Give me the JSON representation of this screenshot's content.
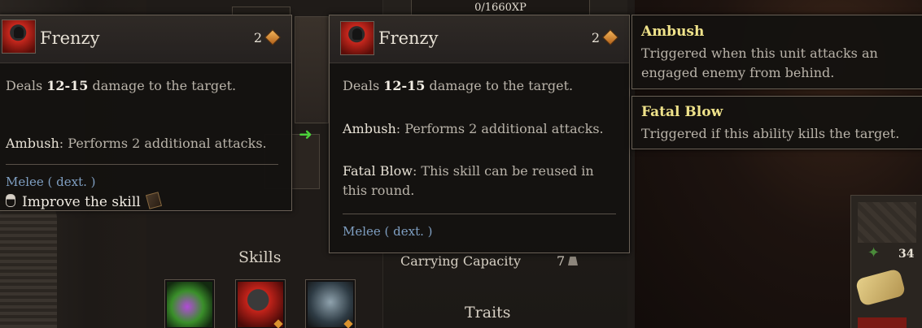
{
  "xp": "0/1660XP",
  "sections": {
    "skills": "Skills",
    "traits": "Traits"
  },
  "stat": {
    "label": "Carrying Capacity",
    "value": "7"
  },
  "inventory": {
    "count": "34"
  },
  "tooltip_left": {
    "title": "Frenzy",
    "cost": "2",
    "damage_prefix": "Deals ",
    "damage": "12-15",
    "damage_suffix": " damage to the target.",
    "ambush_kw": "Ambush",
    "ambush_text": ": Performs 2 additional attacks.",
    "type": "Melee ( dext. )",
    "improve": "Improve the skill"
  },
  "tooltip_main": {
    "title": "Frenzy",
    "cost": "2",
    "damage_prefix": "Deals ",
    "damage": "12-15",
    "damage_suffix": " damage to the target.",
    "ambush_kw": "Ambush",
    "ambush_text": ": Performs 2 additional attacks.",
    "fatal_kw": "Fatal Blow",
    "fatal_text": ": This skill can be reused in this round.",
    "type": "Melee ( dext. )"
  },
  "keywords": [
    {
      "title": "Ambush",
      "desc": "Triggered when this unit attacks an engaged enemy from behind."
    },
    {
      "title": "Fatal Blow",
      "desc": "Triggered if this ability kills the target."
    }
  ],
  "icons": {
    "skill_icon": "frenzy-skill-icon",
    "cost_icon": "action-point-gem-icon",
    "mouse_icon": "mouse-click-icon",
    "book_icon": "skill-book-icon",
    "arrow_icon": "green-arrow-icon"
  },
  "colors": {
    "keyword_title": "#efe28a",
    "melee": "#7f9fc2",
    "accent_gem": "#d9922e"
  }
}
